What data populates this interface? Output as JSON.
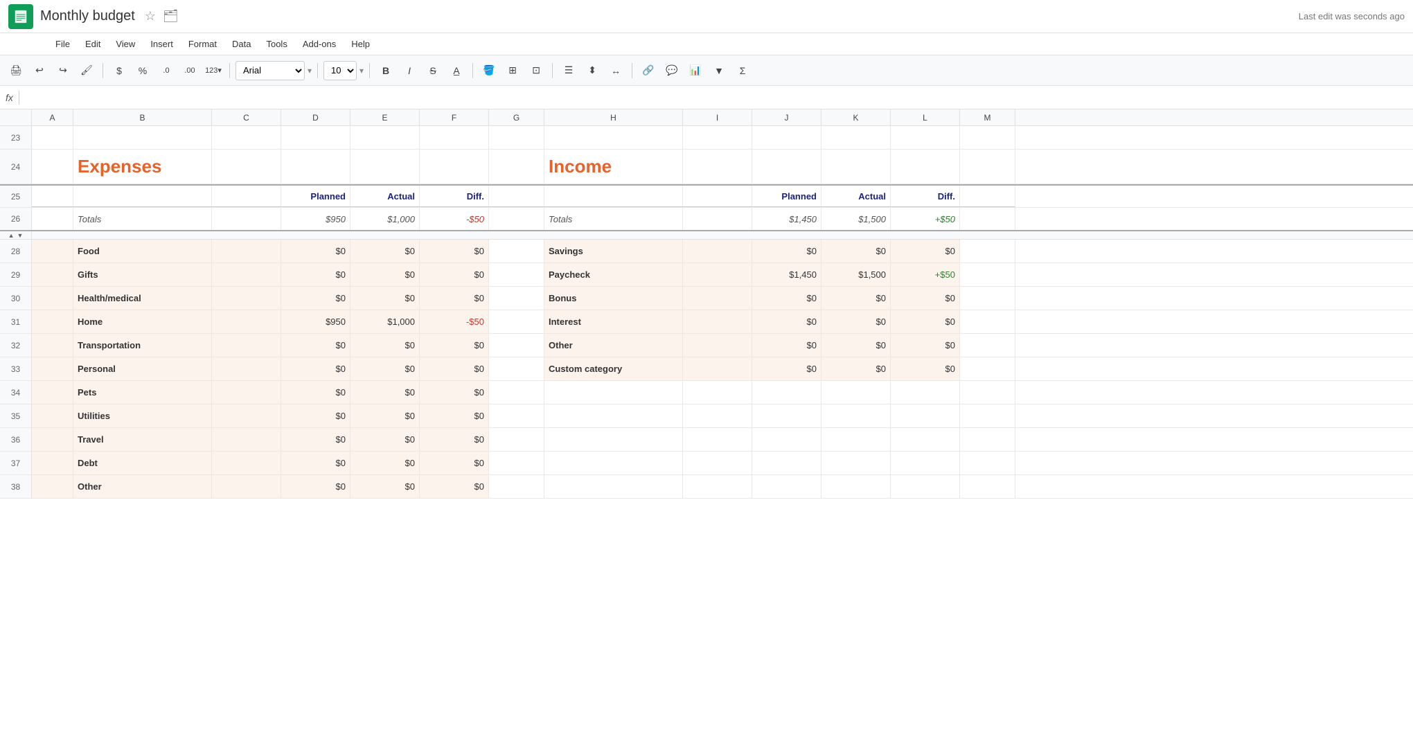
{
  "app": {
    "title": "Monthly budget",
    "last_edit": "Last edit was seconds ago"
  },
  "menu": {
    "items": [
      "File",
      "Edit",
      "View",
      "Insert",
      "Format",
      "Data",
      "Tools",
      "Add-ons",
      "Help"
    ]
  },
  "toolbar": {
    "font": "Arial",
    "font_size": "10",
    "bold": "B",
    "italic": "I",
    "strikethrough": "S"
  },
  "columns": [
    "A",
    "B",
    "C",
    "D",
    "E",
    "F",
    "G",
    "H",
    "I",
    "J",
    "K",
    "L",
    "M"
  ],
  "expenses": {
    "title": "Expenses",
    "headers": {
      "planned": "Planned",
      "actual": "Actual",
      "diff": "Diff."
    },
    "totals": {
      "label": "Totals",
      "planned": "$950",
      "actual": "$1,000",
      "diff": "-$50"
    },
    "rows": [
      {
        "label": "Food",
        "planned": "$0",
        "actual": "$0",
        "diff": "$0"
      },
      {
        "label": "Gifts",
        "planned": "$0",
        "actual": "$0",
        "diff": "$0"
      },
      {
        "label": "Health/medical",
        "planned": "$0",
        "actual": "$0",
        "diff": "$0"
      },
      {
        "label": "Home",
        "planned": "$950",
        "actual": "$1,000",
        "diff": "-$50"
      },
      {
        "label": "Transportation",
        "planned": "$0",
        "actual": "$0",
        "diff": "$0"
      },
      {
        "label": "Personal",
        "planned": "$0",
        "actual": "$0",
        "diff": "$0"
      },
      {
        "label": "Pets",
        "planned": "$0",
        "actual": "$0",
        "diff": "$0"
      },
      {
        "label": "Utilities",
        "planned": "$0",
        "actual": "$0",
        "diff": "$0"
      },
      {
        "label": "Travel",
        "planned": "$0",
        "actual": "$0",
        "diff": "$0"
      },
      {
        "label": "Debt",
        "planned": "$0",
        "actual": "$0",
        "diff": "$0"
      },
      {
        "label": "Other",
        "planned": "$0",
        "actual": "$0",
        "diff": "$0"
      }
    ]
  },
  "income": {
    "title": "Income",
    "headers": {
      "planned": "Planned",
      "actual": "Actual",
      "diff": "Diff."
    },
    "totals": {
      "label": "Totals",
      "planned": "$1,450",
      "actual": "$1,500",
      "diff": "+$50"
    },
    "rows": [
      {
        "label": "Savings",
        "planned": "$0",
        "actual": "$0",
        "diff": "$0"
      },
      {
        "label": "Paycheck",
        "planned": "$1,450",
        "actual": "$1,500",
        "diff": "+$50"
      },
      {
        "label": "Bonus",
        "planned": "$0",
        "actual": "$0",
        "diff": "$0"
      },
      {
        "label": "Interest",
        "planned": "$0",
        "actual": "$0",
        "diff": "$0"
      },
      {
        "label": "Other",
        "planned": "$0",
        "actual": "$0",
        "diff": "$0"
      },
      {
        "label": "Custom category",
        "planned": "$0",
        "actual": "$0",
        "diff": "$0"
      }
    ]
  },
  "row_numbers": [
    "23",
    "24",
    "25",
    "26",
    "",
    "28",
    "29",
    "30",
    "31",
    "32",
    "33",
    "34",
    "35",
    "36",
    "37",
    "38"
  ]
}
